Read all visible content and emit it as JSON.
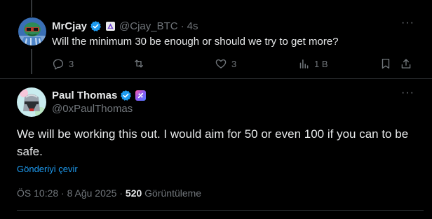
{
  "reply_tweet": {
    "display_name": "MrCjay",
    "handle": "@Cjay_BTC",
    "separator": "·",
    "time": "4s",
    "text": "Will the minimum 30 be enough or should we try to get more?",
    "more_label": "···",
    "actions": {
      "replies": "3",
      "reposts": "",
      "likes": "3",
      "views": "1 B"
    }
  },
  "main_tweet": {
    "display_name": "Paul Thomas",
    "handle": "@0xPaulThomas",
    "more_label": "···",
    "text": "We will be working this out. I would aim for 50 or even 100 if you can to be safe.",
    "translate_label": "Gönderiyi çevir",
    "timestamp": "ÖS 10:28 · 8 Ağu 2025",
    "meta_sep": " · ",
    "views_count": "520",
    "views_label": "Görüntüleme"
  },
  "top_more_label": "···",
  "colors": {
    "background": "#000000",
    "text": "#e7e9ea",
    "muted": "#71767b",
    "link": "#1d9bf0",
    "verified": "#1d9bf0",
    "divider": "#2f3336"
  },
  "icons": {
    "verified": "verified-badge-icon",
    "affiliate": "affiliate-badge-icon",
    "reply": "reply-icon",
    "repost": "repost-icon",
    "like": "heart-icon",
    "views": "views-bar-chart-icon",
    "bookmark": "bookmark-icon",
    "share": "share-icon"
  }
}
